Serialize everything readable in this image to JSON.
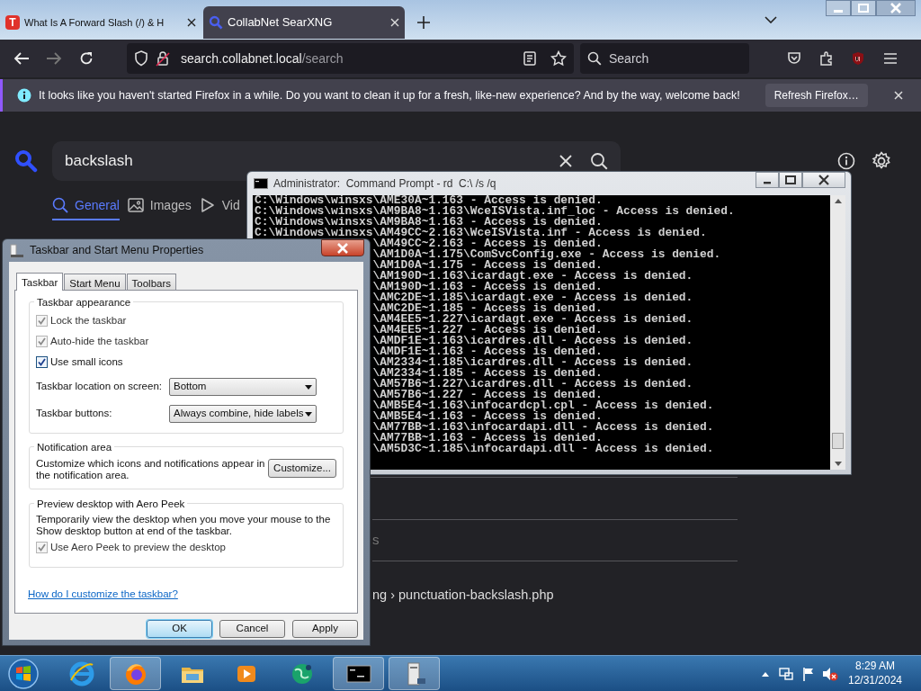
{
  "browser": {
    "tabs": [
      {
        "title": "What Is A Forward Slash (/) & H",
        "favicon_letter": "T",
        "selected": false
      },
      {
        "title": "CollabNet SearXNG",
        "selected": true
      }
    ],
    "url": {
      "host": "search.collabnet.local",
      "path": "/search"
    },
    "search_placeholder": "Search",
    "notification": {
      "message": "It looks like you haven't started Firefox in a while. Do you want to clean it up for a fresh, like-new experience? And by the way, welcome back!",
      "button": "Refresh Firefox…"
    }
  },
  "page": {
    "query": "backslash",
    "categories": [
      {
        "label": "General",
        "selected": true
      },
      {
        "label": "Images",
        "selected": false
      },
      {
        "label": "Vid",
        "selected": false
      }
    ],
    "result_fragments": [
      "s",
      "ng › punctuation-backslash.php"
    ]
  },
  "cmd": {
    "title": "Administrator:  Command Prompt - rd  C:\\ /s /q",
    "lines": [
      {
        "kind": "full",
        "text": "C:\\Windows\\winsxs\\AME30A~1.163 - Access is denied."
      },
      {
        "kind": "full",
        "text": "C:\\Windows\\winsxs\\AM9BA8~1.163\\WceISVista.inf_loc - Access is denied."
      },
      {
        "kind": "full",
        "text": "C:\\Windows\\winsxs\\AM9BA8~1.163 - Access is denied."
      },
      {
        "kind": "full",
        "text": "C:\\Windows\\winsxs\\AM49CC~2.163\\WceISVista.inf - Access is denied."
      },
      {
        "kind": "cut",
        "text": "\\AM49CC~2.163 - Access is denied."
      },
      {
        "kind": "cut",
        "text": "\\AM1D0A~1.175\\ComSvcConfig.exe - Access is denied."
      },
      {
        "kind": "cut",
        "text": "\\AM1D0A~1.175 - Access is denied."
      },
      {
        "kind": "cut",
        "text": "\\AM190D~1.163\\icardagt.exe - Access is denied."
      },
      {
        "kind": "cut",
        "text": "\\AM190D~1.163 - Access is denied."
      },
      {
        "kind": "cut",
        "text": "\\AMC2DE~1.185\\icardagt.exe - Access is denied."
      },
      {
        "kind": "cut",
        "text": "\\AMC2DE~1.185 - Access is denied."
      },
      {
        "kind": "cut",
        "text": "\\AM4EE5~1.227\\icardagt.exe - Access is denied."
      },
      {
        "kind": "cut",
        "text": "\\AM4EE5~1.227 - Access is denied."
      },
      {
        "kind": "cut",
        "text": "\\AMDF1E~1.163\\icardres.dll - Access is denied."
      },
      {
        "kind": "cut",
        "text": "\\AMDF1E~1.163 - Access is denied."
      },
      {
        "kind": "cut",
        "text": "\\AM2334~1.185\\icardres.dll - Access is denied."
      },
      {
        "kind": "cut",
        "text": "\\AM2334~1.185 - Access is denied."
      },
      {
        "kind": "cut",
        "text": "\\AM57B6~1.227\\icardres.dll - Access is denied."
      },
      {
        "kind": "cut",
        "text": "\\AM57B6~1.227 - Access is denied."
      },
      {
        "kind": "cut",
        "text": "\\AMB5E4~1.163\\infocardcpl.cpl - Access is denied."
      },
      {
        "kind": "cut",
        "text": "\\AMB5E4~1.163 - Access is denied."
      },
      {
        "kind": "cut",
        "text": "\\AM77BB~1.163\\infocardapi.dll - Access is denied."
      },
      {
        "kind": "cut",
        "text": "\\AM77BB~1.163 - Access is denied."
      },
      {
        "kind": "cut",
        "text": "\\AM5D3C~1.185\\infocardapi.dll - Access is denied."
      }
    ]
  },
  "dialog": {
    "title": "Taskbar and Start Menu Properties",
    "tabs": [
      {
        "label": "Taskbar",
        "selected": true
      },
      {
        "label": "Start Menu",
        "selected": false
      },
      {
        "label": "Toolbars",
        "selected": false
      }
    ],
    "appearance": {
      "legend": "Taskbar appearance",
      "checks": [
        {
          "label": "Lock the taskbar",
          "checked": true,
          "disabled": true
        },
        {
          "label": "Auto-hide the taskbar",
          "checked": true,
          "disabled": true
        },
        {
          "label": "Use small icons",
          "checked": true,
          "disabled": false
        }
      ],
      "location_label": "Taskbar location on screen:",
      "location_value": "Bottom",
      "buttons_label": "Taskbar buttons:",
      "buttons_value": "Always combine, hide labels"
    },
    "notification_area": {
      "legend": "Notification area",
      "text": "Customize which icons and notifications appear in the notification area.",
      "button": "Customize..."
    },
    "peek": {
      "legend": "Preview desktop with Aero Peek",
      "text": "Temporarily view the desktop when you move your mouse to the Show desktop button at end of the taskbar.",
      "check": {
        "label": "Use Aero Peek to preview the desktop",
        "checked": true,
        "disabled": true
      }
    },
    "link": "How do I customize the taskbar?",
    "buttons": [
      {
        "label": "OK",
        "default": true
      },
      {
        "label": "Cancel",
        "default": false
      },
      {
        "label": "Apply",
        "default": false
      }
    ]
  },
  "taskbar": {
    "items": [
      {
        "kind": "ie",
        "active": false
      },
      {
        "kind": "firefox",
        "active": true
      },
      {
        "kind": "folder",
        "active": false
      },
      {
        "kind": "media",
        "active": false
      },
      {
        "kind": "globe",
        "active": false
      },
      {
        "kind": "cmd",
        "active": true
      },
      {
        "kind": "server",
        "active": true
      }
    ],
    "time": "8:29 AM",
    "date": "12/31/2024"
  }
}
